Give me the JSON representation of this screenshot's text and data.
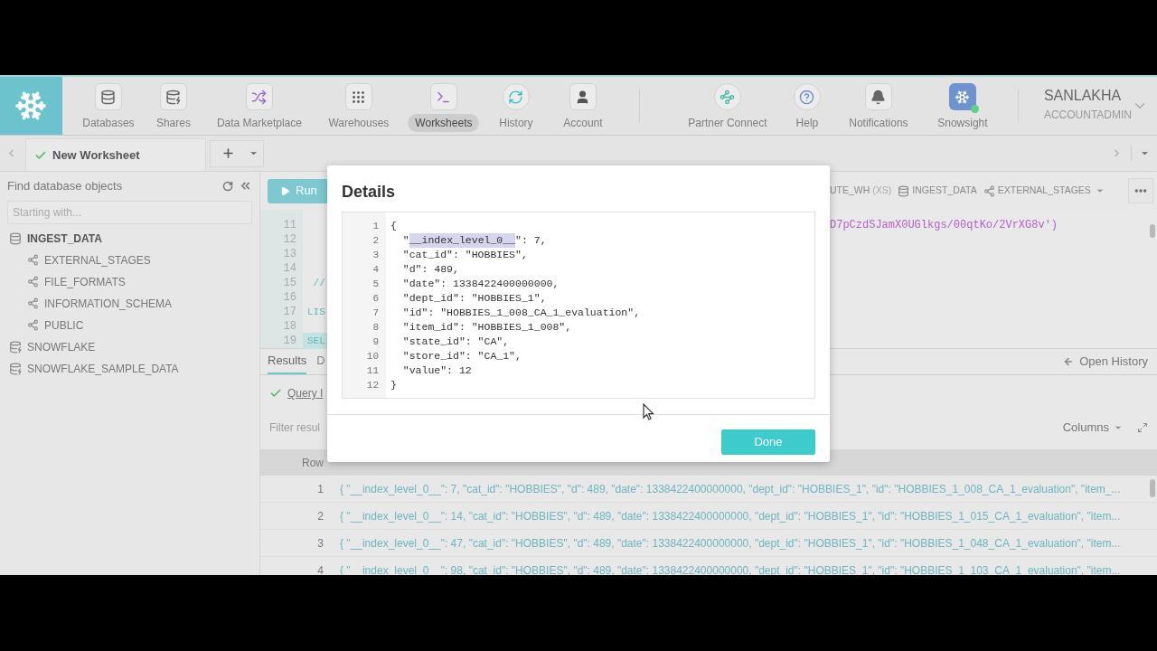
{
  "nav": [
    {
      "label": "Databases",
      "kind": "databases",
      "selected": false
    },
    {
      "label": "Shares",
      "kind": "shares",
      "selected": false
    },
    {
      "label": "Data Marketplace",
      "kind": "marketplace",
      "selected": false
    },
    {
      "label": "Warehouses",
      "kind": "warehouses",
      "selected": false
    },
    {
      "label": "Worksheets",
      "kind": "worksheets",
      "selected": true
    },
    {
      "label": "History",
      "kind": "history",
      "selected": false
    },
    {
      "label": "Account",
      "kind": "account",
      "selected": false
    }
  ],
  "nav_right": [
    {
      "label": "Partner Connect",
      "kind": "partner",
      "selected": false
    },
    {
      "label": "Help",
      "kind": "help",
      "selected": false
    },
    {
      "label": "Notifications",
      "kind": "notifications",
      "selected": false
    },
    {
      "label": "Snowsight",
      "kind": "snowsight",
      "selected": false
    }
  ],
  "user": {
    "name": "SANLAKHA",
    "role": "ACCOUNTADMIN"
  },
  "worksheet_tabs": [
    {
      "label": "New Worksheet",
      "selected": true
    }
  ],
  "sidebar": {
    "title": "Find database objects",
    "search": {
      "placeholder": "Starting with..."
    },
    "tree": [
      {
        "label": "INGEST_DATA",
        "kind": "database",
        "expanded": true,
        "children": [
          {
            "label": "EXTERNAL_STAGES",
            "kind": "schema"
          },
          {
            "label": "FILE_FORMATS",
            "kind": "schema"
          },
          {
            "label": "INFORMATION_SCHEMA",
            "kind": "schema"
          },
          {
            "label": "PUBLIC",
            "kind": "schema"
          }
        ]
      },
      {
        "label": "SNOWFLAKE",
        "kind": "shared_database",
        "expanded": false
      },
      {
        "label": "SNOWFLAKE_SAMPLE_DATA",
        "kind": "shared_database",
        "expanded": false
      }
    ]
  },
  "toolbar": {
    "run": "Run",
    "warehouse": "UTE_WH",
    "size": "(XS)",
    "database": "INGEST_DATA",
    "schema": "EXTERNAL_STAGES"
  },
  "editor": {
    "lines": [
      {
        "number": "11",
        "highlighted": false,
        "right": "D7pCzdSJamX0UGlkgs/00qtKo/2VrXG8v')"
      },
      {
        "number": "12",
        "highlighted": false
      },
      {
        "number": "13",
        "highlighted": false
      },
      {
        "number": "14",
        "highlighted": false
      },
      {
        "number": "15",
        "highlighted": false,
        "left": " //"
      },
      {
        "number": "16",
        "highlighted": false
      },
      {
        "number": "17",
        "highlighted": false,
        "left": "LIS"
      },
      {
        "number": "18",
        "highlighted": false
      },
      {
        "number": "19",
        "highlighted": true,
        "left": "SEL"
      }
    ]
  },
  "results": {
    "tabs": [
      {
        "label": "Results",
        "selected": true
      },
      {
        "label": "D",
        "selected": false
      }
    ],
    "open_history": "Open History",
    "query_link": "Query I",
    "filter_placeholder": "Filter resul",
    "columns_button": "Columns",
    "table": {
      "columns": [
        "Row"
      ],
      "rows": [
        {
          "row": "1",
          "value": "{ \"__index_level_0__\": 7, \"cat_id\": \"HOBBIES\", \"d\": 489, \"date\": 1338422400000000, \"dept_id\": \"HOBBIES_1\", \"id\": \"HOBBIES_1_008_CA_1_evaluation\", \"item_..."
        },
        {
          "row": "2",
          "value": "{ \"__index_level_0__\": 14, \"cat_id\": \"HOBBIES\", \"d\": 489, \"date\": 1338422400000000, \"dept_id\": \"HOBBIES_1\", \"id\": \"HOBBIES_1_015_CA_1_evaluation\", \"item..."
        },
        {
          "row": "3",
          "value": "{ \"__index_level_0__\": 47, \"cat_id\": \"HOBBIES\", \"d\": 489, \"date\": 1338422400000000, \"dept_id\": \"HOBBIES_1\", \"id\": \"HOBBIES_1_048_CA_1_evaluation\", \"item..."
        },
        {
          "row": "4",
          "value": "{ \"__index_level_0__\": 98, \"cat_id\": \"HOBBIES\", \"d\": 489, \"date\": 1338422400000000, \"dept_id\": \"HOBBIES_1\", \"id\": \"HOBBIES_1_103_CA_1_evaluation\", \"item..."
        }
      ]
    }
  },
  "dialog": {
    "title": "Details",
    "lines": [
      {
        "number": "1",
        "parts": [
          {
            "text": "{",
            "selected": false
          }
        ]
      },
      {
        "number": "2",
        "parts": [
          {
            "text": "  \"",
            "selected": false
          },
          {
            "text": "__index_level_0__",
            "selected": true
          },
          {
            "text": "\": 7,",
            "selected": false
          }
        ]
      },
      {
        "number": "3",
        "parts": [
          {
            "text": "  \"cat_id\": \"HOBBIES\",",
            "selected": false
          }
        ]
      },
      {
        "number": "4",
        "parts": [
          {
            "text": "  \"d\": 489,",
            "selected": false
          }
        ]
      },
      {
        "number": "5",
        "parts": [
          {
            "text": "  \"date\": 1338422400000000,",
            "selected": false
          }
        ]
      },
      {
        "number": "6",
        "parts": [
          {
            "text": "  \"dept_id\": \"HOBBIES_1\",",
            "selected": false
          }
        ]
      },
      {
        "number": "7",
        "parts": [
          {
            "text": "  \"id\": \"HOBBIES_1_008_CA_1_evaluation\",",
            "selected": false
          }
        ]
      },
      {
        "number": "8",
        "parts": [
          {
            "text": "  \"item_id\": \"HOBBIES_1_008\",",
            "selected": false
          }
        ]
      },
      {
        "number": "9",
        "parts": [
          {
            "text": "  \"state_id\": \"CA\",",
            "selected": false
          }
        ]
      },
      {
        "number": "10",
        "parts": [
          {
            "text": "  \"store_id\": \"CA_1\",",
            "selected": false
          }
        ]
      },
      {
        "number": "11",
        "parts": [
          {
            "text": "  \"value\": 12",
            "selected": false
          }
        ]
      },
      {
        "number": "12",
        "parts": [
          {
            "text": "}",
            "selected": false
          }
        ]
      }
    ],
    "done": "Done"
  }
}
